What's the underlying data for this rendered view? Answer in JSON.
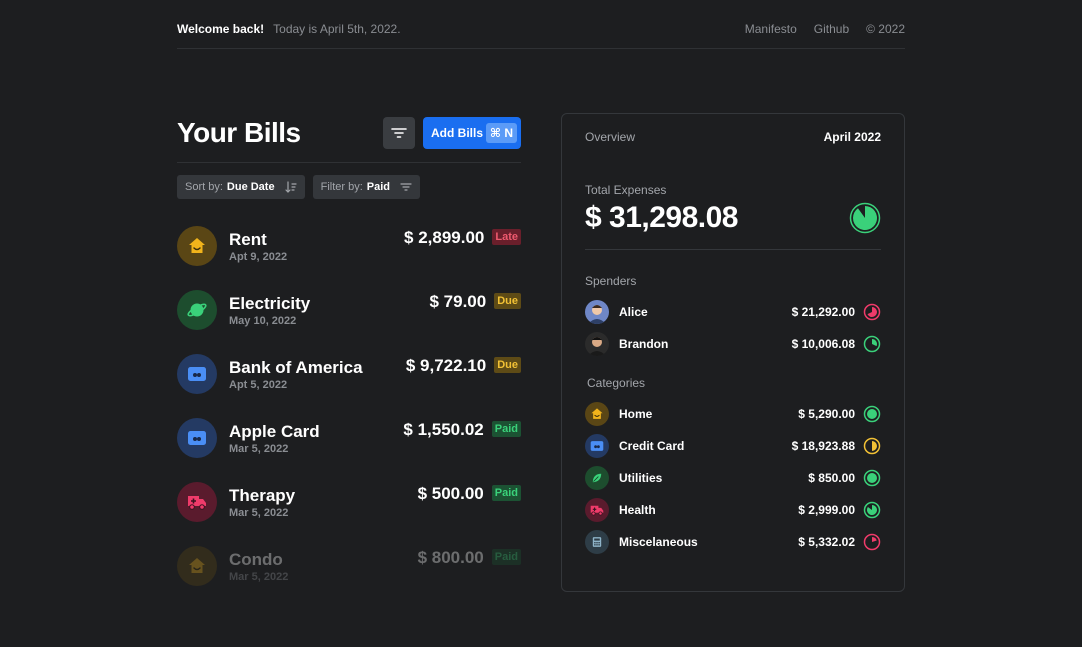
{
  "topbar": {
    "welcome": "Welcome back!",
    "today": "Today is April 5th, 2022.",
    "links": [
      "Manifesto",
      "Github",
      "© 2022"
    ]
  },
  "bills": {
    "title": "Your Bills",
    "add_label": "Add Bills",
    "shortcut": "⌘ N",
    "sort_key": "Sort by:",
    "sort_value": "Due Date",
    "filter_key": "Filter by:",
    "filter_value": "Paid",
    "items": [
      {
        "name": "Rent",
        "date": "Apt 9, 2022",
        "amount": "$ 2,899.00",
        "status": "Late",
        "icon": "house-icon",
        "color": "#f2b41b",
        "bg": "#5a4615"
      },
      {
        "name": "Electricity",
        "date": "May 10, 2022",
        "amount": "$ 79.00",
        "status": "Due",
        "icon": "planet-icon",
        "color": "#3ad17a",
        "bg": "#1d4d2e"
      },
      {
        "name": "Bank of America",
        "date": "Apt 5, 2022",
        "amount": "$ 9,722.10",
        "status": "Due",
        "icon": "card-icon",
        "color": "#4a8ef5",
        "bg": "#243a63"
      },
      {
        "name": "Apple Card",
        "date": "Mar 5, 2022",
        "amount": "$ 1,550.02",
        "status": "Paid",
        "icon": "card-icon",
        "color": "#4a8ef5",
        "bg": "#243a63"
      },
      {
        "name": "Therapy",
        "date": "Mar 5, 2022",
        "amount": "$ 500.00",
        "status": "Paid",
        "icon": "ambulance-icon",
        "color": "#ef3b6a",
        "bg": "#5a1b2d"
      },
      {
        "name": "Condo",
        "date": "Mar 5, 2022",
        "amount": "$ 800.00",
        "status": "Paid",
        "icon": "house-icon",
        "color": "#f2b41b",
        "bg": "#5a4615"
      }
    ]
  },
  "overview": {
    "title": "Overview",
    "period": "April 2022",
    "total_label": "Total Expenses",
    "total_value": "$ 31,298.08",
    "total_fraction": 0.9,
    "spenders_label": "Spenders",
    "spenders": [
      {
        "name": "Alice",
        "amount": "$ 21,292.00",
        "fraction": 0.68,
        "color": "#ef3b6a"
      },
      {
        "name": "Brandon",
        "amount": "$ 10,006.08",
        "fraction": 0.32,
        "color": "#3ad17a"
      }
    ],
    "categories_label": "Categories",
    "categories": [
      {
        "name": "Home",
        "amount": "$ 5,290.00",
        "fraction": 1.0,
        "color": "#3ad17a",
        "icon": "house-icon",
        "icon_color": "#f2b41b",
        "bg": "#5a4615"
      },
      {
        "name": "Credit Card",
        "amount": "$ 18,923.88",
        "fraction": 0.5,
        "color": "#f2c135",
        "icon": "card-icon",
        "icon_color": "#4a8ef5",
        "bg": "#243a63"
      },
      {
        "name": "Utilities",
        "amount": "$ 850.00",
        "fraction": 1.0,
        "color": "#3ad17a",
        "icon": "leaf-icon",
        "icon_color": "#3ad17a",
        "bg": "#1d4d2e"
      },
      {
        "name": "Health",
        "amount": "$ 2,999.00",
        "fraction": 0.85,
        "color": "#3ad17a",
        "icon": "ambulance-icon",
        "icon_color": "#ef3b6a",
        "bg": "#5a1b2d"
      },
      {
        "name": "Miscelaneous",
        "amount": "$ 5,332.02",
        "fraction": 0.2,
        "color": "#ef3b6a",
        "icon": "calculator-icon",
        "icon_color": "#8fb4c9",
        "bg": "#2e3d47"
      }
    ]
  }
}
